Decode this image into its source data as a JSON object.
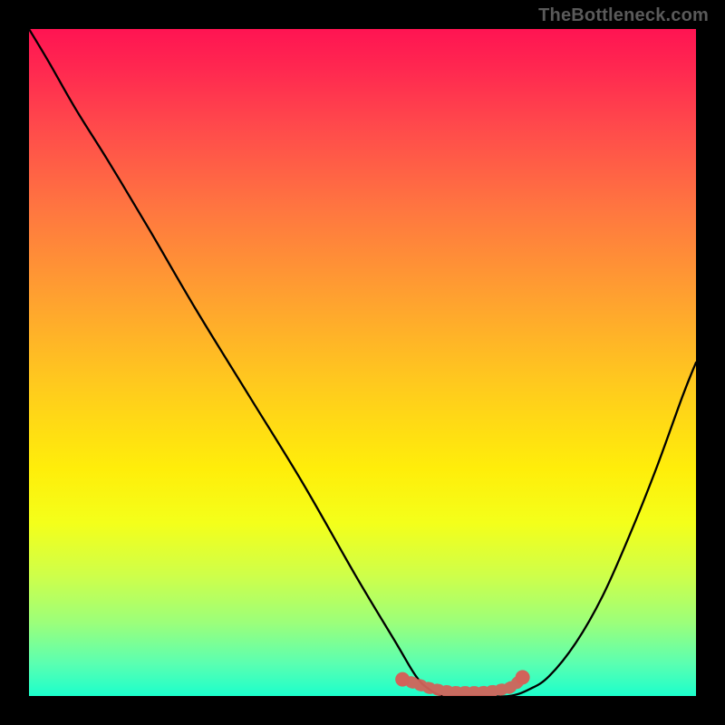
{
  "watermark": "TheBottleneck.com",
  "chart_data": {
    "type": "line",
    "title": "",
    "xlabel": "",
    "ylabel": "",
    "xlim": [
      0,
      100
    ],
    "ylim": [
      0,
      100
    ],
    "grid": false,
    "series": [
      {
        "name": "bottleneck-curve",
        "color": "#000000",
        "x": [
          0,
          3,
          7,
          12,
          18,
          25,
          33,
          41,
          49,
          55,
          58,
          60,
          62,
          64,
          68,
          72,
          75,
          78,
          82,
          86,
          90,
          94,
          98,
          100
        ],
        "y": [
          100,
          95,
          88,
          80,
          70,
          58,
          45,
          32,
          18,
          8,
          3,
          1,
          0,
          0,
          0,
          0,
          1,
          3,
          8,
          15,
          24,
          34,
          45,
          50
        ]
      },
      {
        "name": "optimal-zone-dots",
        "color": "#d1635a",
        "type": "scatter",
        "x": [
          56,
          60,
          62,
          64,
          66,
          68,
          70,
          72,
          73,
          74
        ],
        "y": [
          2.5,
          1.2,
          0.8,
          0.6,
          0.6,
          0.6,
          0.8,
          1.2,
          1.8,
          2.8
        ]
      }
    ],
    "gradient_stops": [
      {
        "pos": 0,
        "color": "#ff1452"
      },
      {
        "pos": 15,
        "color": "#ff4b4b"
      },
      {
        "pos": 40,
        "color": "#ffa030"
      },
      {
        "pos": 66,
        "color": "#ffee0a"
      },
      {
        "pos": 89,
        "color": "#9cff7a"
      },
      {
        "pos": 100,
        "color": "#1cffcc"
      }
    ]
  }
}
